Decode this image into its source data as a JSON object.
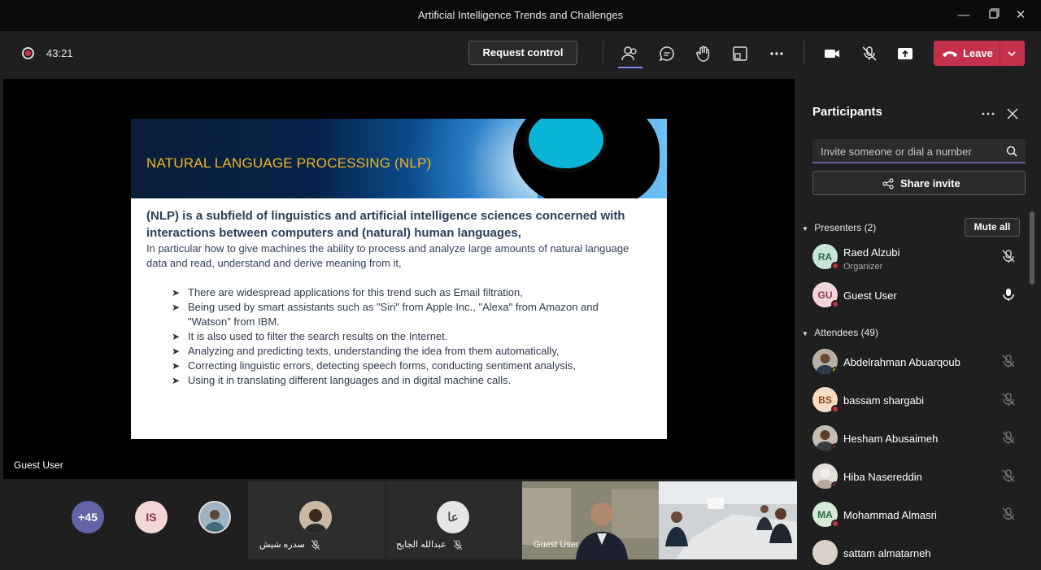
{
  "window": {
    "title": "Artificial Intelligence Trends and Challenges"
  },
  "toolbar": {
    "timer": "43:21",
    "request_control": "Request control",
    "leave": "Leave",
    "leave_color": "#c4314b"
  },
  "slide": {
    "title": "NATURAL LANGUAGE PROCESSING (NLP)",
    "lead": "(NLP) is a subfield of linguistics and artificial intelligence sciences concerned with interactions between computers and (natural) human languages,",
    "sub": "In particular how to give machines the ability to process and analyze large amounts of natural language data and read, understand and derive meaning from it,",
    "bullets": [
      "There are widespread applications for this trend such as Email filtration,",
      "Being used by smart assistants such as \"Siri\" from Apple Inc., \"Alexa\" from Amazon and \"Watson\" from IBM.",
      "It is also used to filter the search results on the Internet.",
      "Analyzing and predicting texts, understanding the idea from them automatically,",
      "Correcting linguistic errors, detecting speech forms, conducting sentiment analysis,",
      "Using it in translating different languages and in digital machine calls."
    ]
  },
  "stage": {
    "presenter_label": "Guest User"
  },
  "strip": {
    "more_count": "+45",
    "is_initials": "IS",
    "tile1_name": "سدره شيش",
    "tile2_initials": "عا",
    "tile2_name": "عبدالله الجايح",
    "tile3_name": "Guest User"
  },
  "panel": {
    "title": "Participants",
    "search_placeholder": "Invite someone or dial a number",
    "share_invite": "Share invite",
    "presenters_label": "Presenters (2)",
    "mute_all": "Mute all",
    "presenters": [
      {
        "initials": "RA",
        "name": "Raed Alzubi",
        "role": "Organizer"
      },
      {
        "initials": "GU",
        "name": "Guest User"
      }
    ],
    "attendees_label": "Attendees (49)",
    "attendees": [
      {
        "initials": "",
        "name": "Abdelrahman Abuarqoub"
      },
      {
        "initials": "BS",
        "name": "bassam shargabi"
      },
      {
        "initials": "",
        "name": "Hesham Abusaimeh"
      },
      {
        "initials": "",
        "name": "Hiba Nasereddin"
      },
      {
        "initials": "MA",
        "name": "Mohammad Almasri"
      },
      {
        "initials": "",
        "name": "sattam almatarneh"
      }
    ]
  }
}
